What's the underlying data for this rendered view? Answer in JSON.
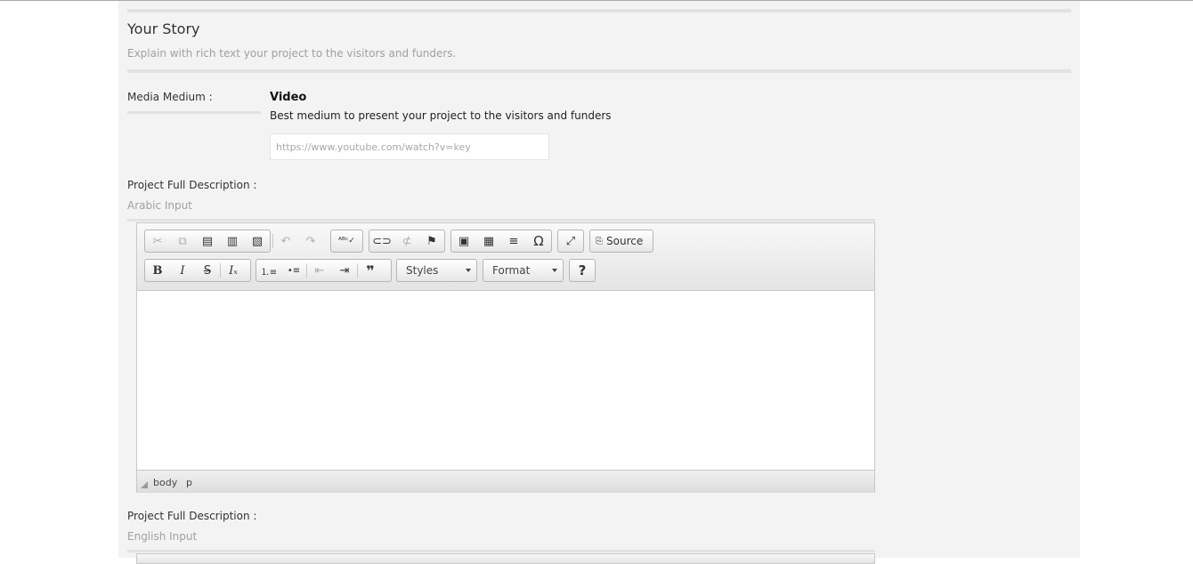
{
  "section": {
    "title": "Your Story",
    "subtitle": "Explain with rich text your project to the visitors and funders."
  },
  "media": {
    "label": "Media Medium :",
    "title": "Video",
    "description": "Best medium to present your project to the visitors and funders",
    "url_placeholder": "https://www.youtube.com/watch?v=key",
    "url_value": ""
  },
  "desc_arabic": {
    "label": "Project Full Description :",
    "hint": "Arabic Input"
  },
  "desc_english": {
    "label": "Project Full Description :",
    "hint": "English Input"
  },
  "editor": {
    "source_label": "Source",
    "styles_label": "Styles",
    "format_label": "Format",
    "help_label": "?",
    "path": [
      "body",
      "p"
    ],
    "icons": {
      "cut": "✂",
      "copy": "⧉",
      "paste": "📋",
      "undo": "↶",
      "redo": "↷",
      "spellcheck": "ᴬᴮᶜ✓",
      "link": "🔗",
      "anchor": "⚑",
      "image": "▣",
      "table": "▦",
      "hr": "≡",
      "omega": "Ω",
      "maximize": "⤢",
      "bold": "B",
      "italic": "I",
      "strike": "S",
      "clear": "Iₓ",
      "numlist": "⒈≡",
      "bullist": "•≡",
      "outdent": "⇤",
      "indent": "⇥",
      "blockquote": "❞"
    }
  }
}
